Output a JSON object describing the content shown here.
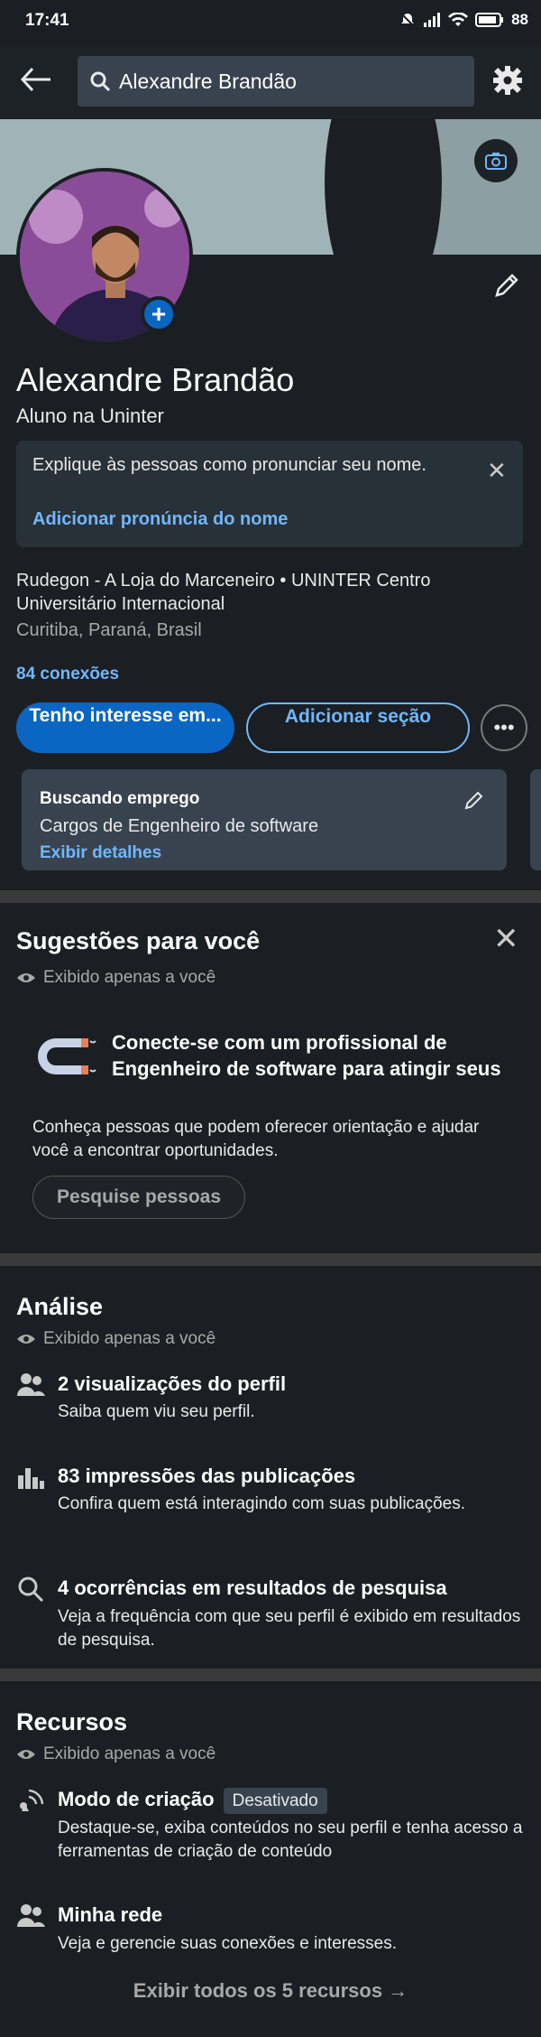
{
  "status": {
    "time": "17:41",
    "battery": "88"
  },
  "search": {
    "value": "Alexandre Brandão"
  },
  "profile": {
    "name": "Alexandre Brandão",
    "headline": "Aluno na Uninter",
    "pronunciation": {
      "text": "Explique às pessoas como pronunciar seu nome.",
      "link": "Adicionar pronúncia do nome"
    },
    "company": "Rudegon - A Loja do Marceneiro • UNINTER Centro Universitário Internacional",
    "location": "Curitiba, Paraná, Brasil",
    "connections": "84 conexões",
    "primary_button": "Tenho interesse em...",
    "secondary_button": "Adicionar seção",
    "more_button": "•••",
    "job": {
      "title": "Buscando emprego",
      "description": "Cargos de Engenheiro de software",
      "link": "Exibir detalhes"
    }
  },
  "suggestions": {
    "title": "Sugestões para você",
    "visibility": "Exibido apenas a você",
    "card_title": "Conecte-se com um profissional de Engenheiro de software para atingir seus objetivos de carreira",
    "card_text": "Conheça pessoas que podem oferecer orientação e ajudar você a encontrar oportunidades.",
    "button": "Pesquise pessoas"
  },
  "analytics": {
    "title": "Análise",
    "visibility": "Exibido apenas a você",
    "items": [
      {
        "icon": "people-icon",
        "title": "2 visualizações do perfil",
        "text": "Saiba quem viu seu perfil."
      },
      {
        "icon": "bar-chart-icon",
        "title": "83 impressões das publicações",
        "text": "Confira quem está interagindo com suas publicações."
      },
      {
        "icon": "search-icon",
        "title": "4 ocorrências em resultados de pesquisa",
        "text": "Veja a frequência com que seu perfil é exibido em resultados de pesquisa."
      }
    ]
  },
  "resources": {
    "title": "Recursos",
    "visibility": "Exibido apenas a você",
    "items": [
      {
        "icon": "broadcast-icon",
        "title": "Modo de criação",
        "badge": "Desativado",
        "text": "Destaque-se, exiba conteúdos no seu perfil e tenha acesso a ferramentas de criação de conteúdo"
      },
      {
        "icon": "people-icon",
        "title": "Minha rede",
        "text": "Veja e gerencie suas conexões e interesses."
      }
    ],
    "show_all": "Exibir todos os 5 recursos →"
  },
  "colors": {
    "accent": "#0a66c2",
    "link": "#71b7fb",
    "background": "#1b1f23"
  }
}
